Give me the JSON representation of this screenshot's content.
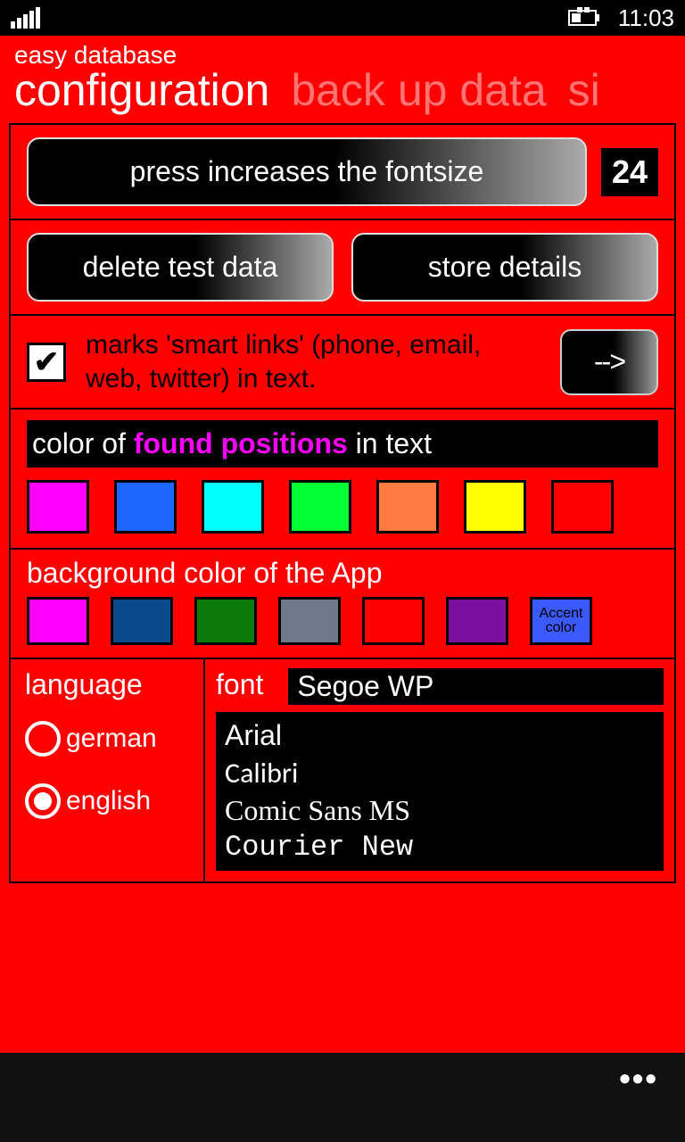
{
  "status": {
    "time": "11:03"
  },
  "header": {
    "app_title": "easy database",
    "tabs": [
      "configuration",
      "back up data",
      "si"
    ]
  },
  "row1": {
    "button_label": "press increases the fontsize",
    "fontsize_value": "24"
  },
  "row2": {
    "delete_label": "delete test data",
    "store_label": "store details"
  },
  "row3": {
    "checked": true,
    "text": "marks 'smart links' (phone, email, web, twitter) in text.",
    "arrow_label": "-->"
  },
  "row4": {
    "label_pre": "color of ",
    "label_highlight": "found positions",
    "label_post": " in text",
    "colors": [
      "#ff00ff",
      "#1e66ff",
      "#00ffff",
      "#00ff33",
      "#ff7a40",
      "#ffff00",
      "#ff0000"
    ]
  },
  "row5": {
    "label": "background color of the App",
    "colors": [
      {
        "c": "#ff00ff",
        "t": ""
      },
      {
        "c": "#0b4a8a",
        "t": ""
      },
      {
        "c": "#0a7a0a",
        "t": ""
      },
      {
        "c": "#6c7a8a",
        "t": ""
      },
      {
        "c": "#ff0000",
        "t": ""
      },
      {
        "c": "#7a0fa0",
        "t": ""
      },
      {
        "c": "#3a5aff",
        "t": "Accent color"
      }
    ]
  },
  "lang": {
    "title": "language",
    "options": [
      {
        "label": "german",
        "selected": false
      },
      {
        "label": "english",
        "selected": true
      }
    ]
  },
  "font": {
    "title": "font",
    "selected": "Segoe WP",
    "list": [
      {
        "name": "Arial",
        "family": "Arial, sans-serif"
      },
      {
        "name": "Calibri",
        "family": "Calibri, 'Segoe UI', sans-serif"
      },
      {
        "name": "Comic Sans MS",
        "family": "'Comic Sans MS', cursive"
      },
      {
        "name": "Courier New",
        "family": "'Courier New', monospace"
      }
    ]
  },
  "bottombar": {
    "dots": "•••"
  }
}
